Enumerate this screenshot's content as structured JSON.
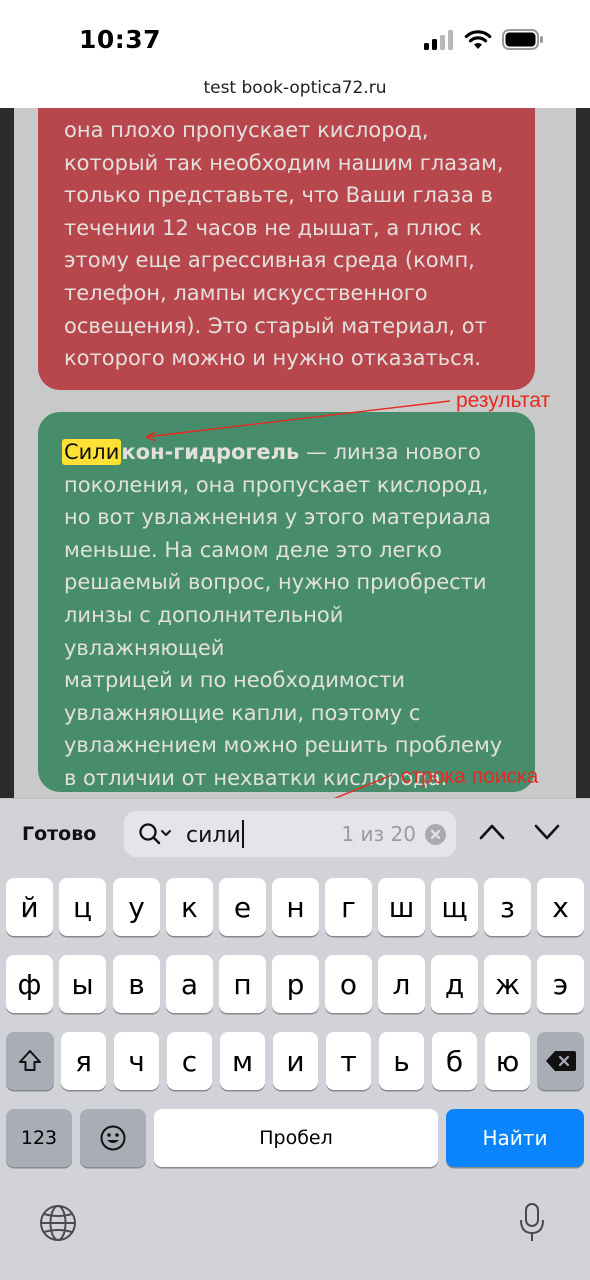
{
  "status_bar": {
    "time": "10:37"
  },
  "browser": {
    "url": "test book-optica72.ru"
  },
  "cards": {
    "red_text": "она плохо пропускает кислород,\nкоторый так необходим нашим глазам,\nтолько представьте, что Ваши глаза в\nтечении 12 часов не дышат, а плюс к\nэтому еще агрессивная среда (комп,\nтелефон, лампы искусственного\nосвещения). Это старый материал, от\nкоторого можно и нужно отказаться.",
    "green_highlight": "Сили",
    "green_bold_rest": "кон-гидрогель",
    "green_text": " — линза нового\nпоколения, она пропускает кислород,\nно вот увлажнения у этого материала\nменьше. На самом деле это легко\nрешаемый вопрос, нужно приобрести\nлинзы с дополнительной увлажняющей\nматрицей и по необходимости\nувлажняющие капли, поэтому с\nувлажнением можно решить проблему\nв отличии от нехватки кислорода."
  },
  "annotations": {
    "result_label": "результат",
    "search_label": "строка поиска"
  },
  "find_bar": {
    "done_label": "Готово",
    "query": "сили",
    "match_count": "1 из 20"
  },
  "keyboard": {
    "row1": [
      "й",
      "ц",
      "у",
      "к",
      "е",
      "н",
      "г",
      "ш",
      "щ",
      "з",
      "х"
    ],
    "row2": [
      "ф",
      "ы",
      "в",
      "а",
      "п",
      "р",
      "о",
      "л",
      "д",
      "ж",
      "э"
    ],
    "row3": [
      "я",
      "ч",
      "с",
      "м",
      "и",
      "т",
      "ь",
      "б",
      "ю"
    ],
    "numbers_label": "123",
    "space_label": "Пробел",
    "go_label": "Найти"
  },
  "icons": {
    "shift": "shift-icon",
    "backspace": "backspace-icon",
    "emoji": "emoji-icon",
    "globe": "globe-icon",
    "mic": "microphone-icon"
  },
  "colors": {
    "red_card": "#b8464d",
    "green_card": "#478d6c",
    "highlight": "#ffe135",
    "annotation": "#e8291f",
    "go_key": "#0a84ff"
  }
}
